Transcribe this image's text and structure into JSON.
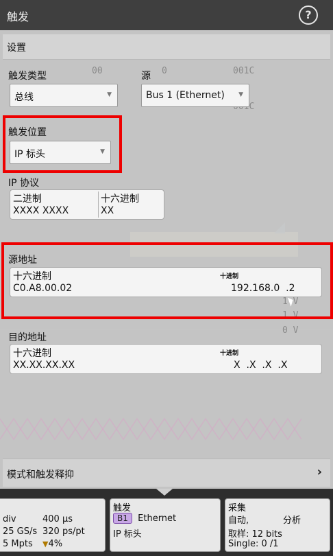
{
  "window": {
    "title": "触发"
  },
  "settings": {
    "header": "设置"
  },
  "trigger_type": {
    "label": "触发类型",
    "value": "总线"
  },
  "source": {
    "label": "源",
    "value": "Bus 1 (Ethernet)"
  },
  "trigger_position": {
    "label": "触发位置",
    "value": "IP 标头"
  },
  "ip_protocol": {
    "label": "IP 协议",
    "binary_caption": "二进制",
    "binary_value": "XXXX XXXX",
    "hex_caption": "十六进制",
    "hex_value": "XX"
  },
  "source_address": {
    "label": "源地址",
    "hex_caption": "十六进制",
    "hex_value": "C0.A8.00.02",
    "dec_caption": "十进制",
    "dec_value": "192.168.0  .2"
  },
  "dest_address": {
    "label": "目的地址",
    "hex_caption": "十六进制",
    "hex_value": "XX.XX.XX.XX",
    "dec_caption": "十进制",
    "dec_value": "X  .X  .X  .X"
  },
  "mode_holdoff": {
    "label": "模式和触发释抑"
  },
  "background": {
    "val_00": "00",
    "val_0": "0",
    "val_001C_a": "001C",
    "val_001C_b": "001C",
    "val_1v_a": "1 V",
    "val_1v_b": "1 V",
    "val_0v": "0 V"
  },
  "status": {
    "horizontal": {
      "row1a": "div",
      "row1b": "400 µs",
      "row2a": "25 GS/s",
      "row2b": "320 ps/pt",
      "row3a": "5 Mpts",
      "row3b": "4%"
    },
    "trigger": {
      "title": "触发",
      "chip": "B1",
      "proto": "Ethernet",
      "pos": "IP 标头"
    },
    "acquisition": {
      "title": "采集",
      "mode": "自动,",
      "analyze": "分析",
      "sample": "取样: 12 bits",
      "single": "Single: 0 /1"
    }
  },
  "colors": {
    "highlight": "#ee0000",
    "panel": "#cecece",
    "b1_chip": "#c8a8e6"
  }
}
